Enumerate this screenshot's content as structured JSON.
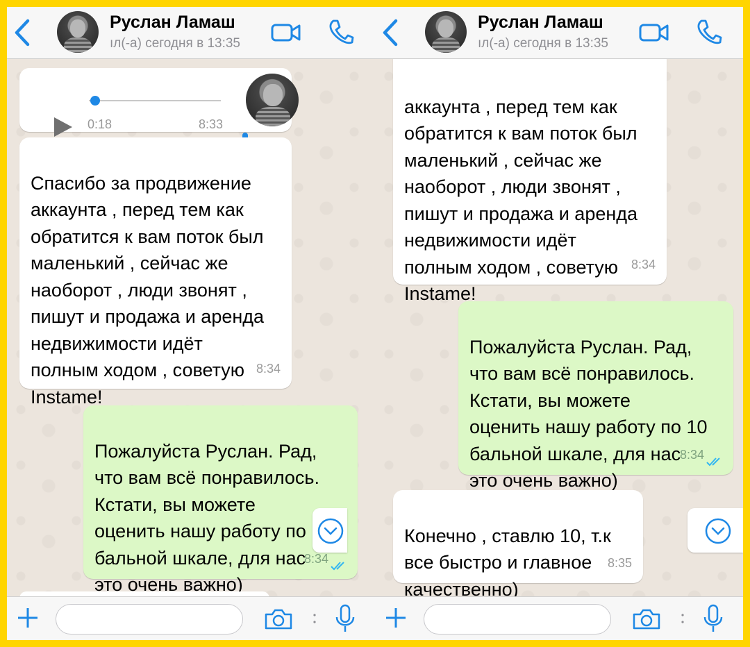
{
  "chat": {
    "contact_name": "Руслан Ламаш",
    "status": "ıл(-а) сегодня в 13:35",
    "input_placeholder": ""
  },
  "left": {
    "voice": {
      "duration": "0:18",
      "time": "8:33",
      "progress": 0.03
    },
    "incoming": {
      "text": "Спасибо за продвижение\nаккаунта ,   перед тем как\nобратится к вам поток был\nмаленький , сейчас же\nнаоборот , люди звонят ,\nпишут и продажа и аренда\nнедвижимости идёт\nполным ходом , советую\nInstame!",
      "time": "8:34"
    },
    "outgoing": {
      "text": "Пожалуйста Руслан. Рад,\nчто вам всё понравилось.\nКстати, вы можете\nоценить нашу работу по 10\nбальной шкале, для нас\nэто очень важно)",
      "time": "8:34"
    }
  },
  "right": {
    "incoming1": {
      "text": "аккаунта ,   перед тем как\nобратится к вам поток был\nмаленький , сейчас же\nнаоборот , люди звонят ,\nпишут и продажа и аренда\nнедвижимости идёт\nполным ходом , советую\nInstame!",
      "time": "8:34"
    },
    "outgoing": {
      "text": "Пожалуйста Руслан. Рад,\nчто вам всё понравилось.\nКстати, вы можете\nоценить нашу работу по 10\nбальной шкале, для нас\nэто очень важно)",
      "time": "8:34"
    },
    "incoming2": {
      "text": "Конечно , ставлю 10, т.к\nвсе быстро и главное\nкачественно)",
      "time": "8:35"
    }
  },
  "colors": {
    "accent": "#1E88E5",
    "frame": "#FFD500",
    "outgoing_bubble": "#DCF8C6",
    "chat_bg": "#ECE5DD"
  },
  "icons": [
    "back-chevron-icon",
    "video-call-icon",
    "phone-icon",
    "play-icon",
    "mic-icon",
    "chevron-down-icon",
    "plus-icon",
    "camera-icon",
    "read-ticks-icon"
  ]
}
